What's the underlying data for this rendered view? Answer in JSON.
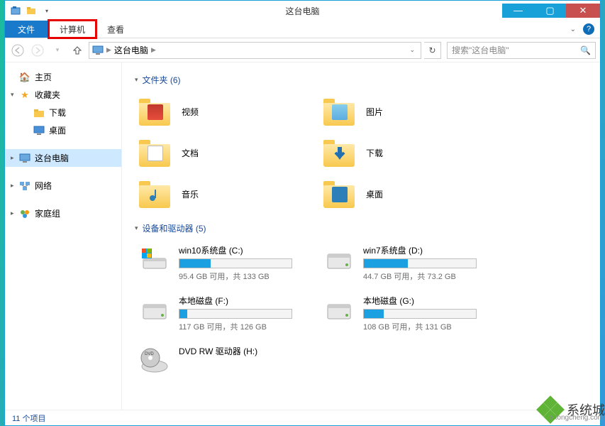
{
  "title": "这台电脑",
  "ribbon": {
    "file": "文件",
    "computer": "计算机",
    "view": "查看"
  },
  "breadcrumb": {
    "root": "这台电脑",
    "sep": "▶"
  },
  "search": {
    "placeholder": "搜索\"这台电脑\""
  },
  "sidebar": {
    "home": "主页",
    "favorites": "收藏夹",
    "downloads": "下载",
    "desktop": "桌面",
    "thispc": "这台电脑",
    "network": "网络",
    "homegroup": "家庭组"
  },
  "sections": {
    "folders_title": "文件夹 (6)",
    "drives_title": "设备和驱动器 (5)"
  },
  "folders": [
    {
      "label": "视频",
      "icon": "video"
    },
    {
      "label": "图片",
      "icon": "picture"
    },
    {
      "label": "文档",
      "icon": "document"
    },
    {
      "label": "下载",
      "icon": "download"
    },
    {
      "label": "音乐",
      "icon": "music"
    },
    {
      "label": "桌面",
      "icon": "desktop"
    }
  ],
  "drives": [
    {
      "name": "win10系统盘 (C:)",
      "free": "95.4 GB 可用，共 133 GB",
      "pct": 28,
      "type": "os"
    },
    {
      "name": "win7系统盘 (D:)",
      "free": "44.7 GB 可用，共 73.2 GB",
      "pct": 39,
      "type": "hdd"
    },
    {
      "name": "本地磁盘 (F:)",
      "free": "117 GB 可用，共 126 GB",
      "pct": 7,
      "type": "hdd"
    },
    {
      "name": "本地磁盘 (G:)",
      "free": "108 GB 可用，共 131 GB",
      "pct": 18,
      "type": "hdd"
    },
    {
      "name": "DVD RW 驱动器 (H:)",
      "free": "",
      "pct": -1,
      "type": "dvd"
    }
  ],
  "status": "11 个项目",
  "watermark": {
    "text": "系统城",
    "sub": "xitongcheng.com"
  }
}
